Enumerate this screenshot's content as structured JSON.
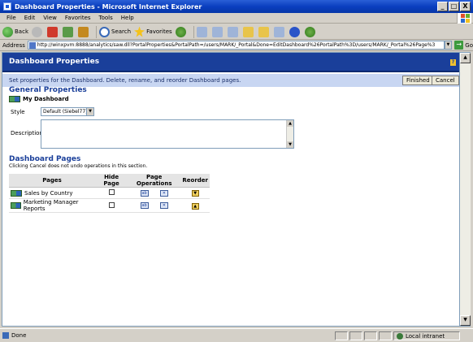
{
  "window": {
    "title": "Dashboard Properties - Microsoft Internet Explorer",
    "buttons": [
      "_",
      "□",
      "X"
    ]
  },
  "menu": [
    "File",
    "Edit",
    "View",
    "Favorites",
    "Tools",
    "Help"
  ],
  "toolbar": {
    "back": "Back",
    "search": "Search",
    "favorites": "Favorites"
  },
  "address": {
    "label": "Address",
    "url": "http://winxpvm:8888/analytics/saw.dll?PortalProperties&PortalPath=/users/MARK/_Portal&Done=EditDashboard%26PortalPath%3D/users/MARK/_Portal%26Page%3",
    "go": "Go"
  },
  "page": {
    "header": "Dashboard Properties",
    "instruction": "Set properties for the Dashboard. Delete, rename, and reorder Dashboard pages.",
    "finished": "Finished",
    "cancel": "Cancel",
    "general_title": "General Properties",
    "dashboard_name": "My Dashboard",
    "style_label": "Style",
    "style_value": "Default (Siebel77)",
    "description_label": "Description:",
    "pages_title": "Dashboard Pages",
    "pages_note": "Clicking Cancel does not undo operations in this section."
  },
  "table": {
    "headers": [
      "Pages",
      "Hide Page",
      "Page Operations",
      "Reorder"
    ],
    "rows": [
      {
        "name": "Sales by Country",
        "reorder": "▼"
      },
      {
        "name": "Marketing Manager Reports",
        "reorder": "▲"
      }
    ]
  },
  "status": {
    "text": "Done",
    "zone": "Local intranet"
  }
}
